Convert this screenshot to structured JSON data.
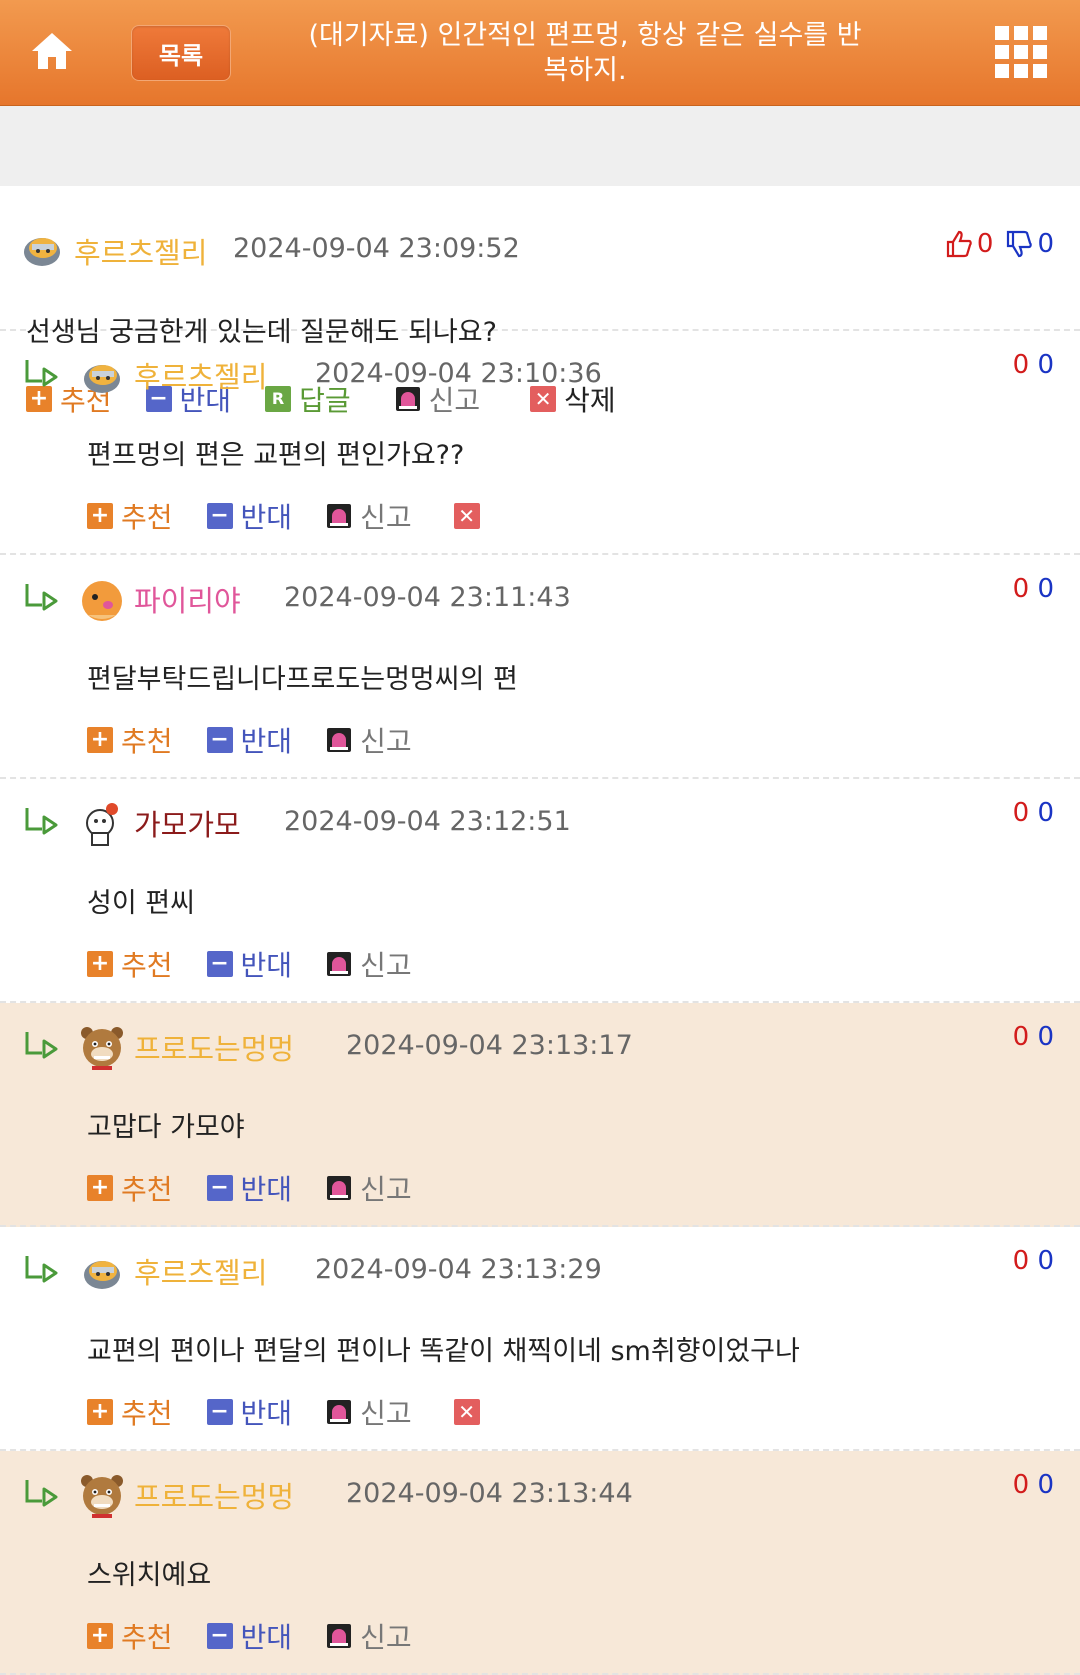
{
  "header": {
    "list_label": "목록",
    "title": "(대기자료) 인간적인 편프멍, 항상 같은 실수를 반복하지."
  },
  "post": {
    "nick": "후르츠젤리",
    "nick_color": "#efb23a",
    "date": "2024-09-04 23:09:52",
    "up": "0",
    "down": "0",
    "body": "선생님 궁금한게 있는데 질문해도 되나요?",
    "actions": {
      "recommend": "추천",
      "oppose": "반대",
      "reply": "답글",
      "report": "신고",
      "delete": "삭제"
    }
  },
  "comments": [
    {
      "nick": "후르츠젤리",
      "nick_color": "#efb23a",
      "date": "2024-09-04 23:10:36",
      "up": "0",
      "down": "0",
      "body": "편프멍의 편은 교편의 편인가요??",
      "recommend": "추천",
      "oppose": "반대",
      "report": "신고",
      "has_delete": true,
      "highlight": false,
      "avatar": "jelly"
    },
    {
      "nick": "파이리야",
      "nick_color": "#e0569a",
      "date": "2024-09-04 23:11:43",
      "up": "0",
      "down": "0",
      "body": "편달부탁드립니다프로도는멍멍씨의 편",
      "recommend": "추천",
      "oppose": "반대",
      "report": "신고",
      "has_delete": false,
      "highlight": false,
      "avatar": "charmander"
    },
    {
      "nick": "가모가모",
      "nick_color": "#8b1a1a",
      "date": "2024-09-04 23:12:51",
      "up": "0",
      "down": "0",
      "body": "성이 편씨",
      "recommend": "추천",
      "oppose": "반대",
      "report": "신고",
      "has_delete": false,
      "highlight": false,
      "avatar": "rabbit"
    },
    {
      "nick": "프로도는멍멍",
      "nick_color": "#efb23a",
      "date": "2024-09-04 23:13:17",
      "up": "0",
      "down": "0",
      "body": "고맙다 가모야",
      "recommend": "추천",
      "oppose": "반대",
      "report": "신고",
      "has_delete": false,
      "highlight": true,
      "avatar": "frodo"
    },
    {
      "nick": "후르츠젤리",
      "nick_color": "#efb23a",
      "date": "2024-09-04 23:13:29",
      "up": "0",
      "down": "0",
      "body": "교편의 편이나 편달의 편이나 똑같이 채찍이네 sm취향이었구나",
      "recommend": "추천",
      "oppose": "반대",
      "report": "신고",
      "has_delete": true,
      "highlight": false,
      "avatar": "jelly"
    },
    {
      "nick": "프로도는멍멍",
      "nick_color": "#efb23a",
      "date": "2024-09-04 23:13:44",
      "up": "0",
      "down": "0",
      "body": "스위치예요",
      "recommend": "추천",
      "oppose": "반대",
      "report": "신고",
      "has_delete": false,
      "highlight": true,
      "avatar": "frodo"
    }
  ],
  "icons": {
    "home": "home-icon",
    "grid": "grid-menu-icon",
    "thumbs_up": "thumbs-up-icon",
    "thumbs_down": "thumbs-down-icon",
    "reply_arrow": "reply-arrow-icon",
    "plus": "plus-icon",
    "minus": "minus-icon",
    "reply_r": "reply-r-icon",
    "siren": "siren-icon",
    "delete_x": "delete-x-icon"
  }
}
